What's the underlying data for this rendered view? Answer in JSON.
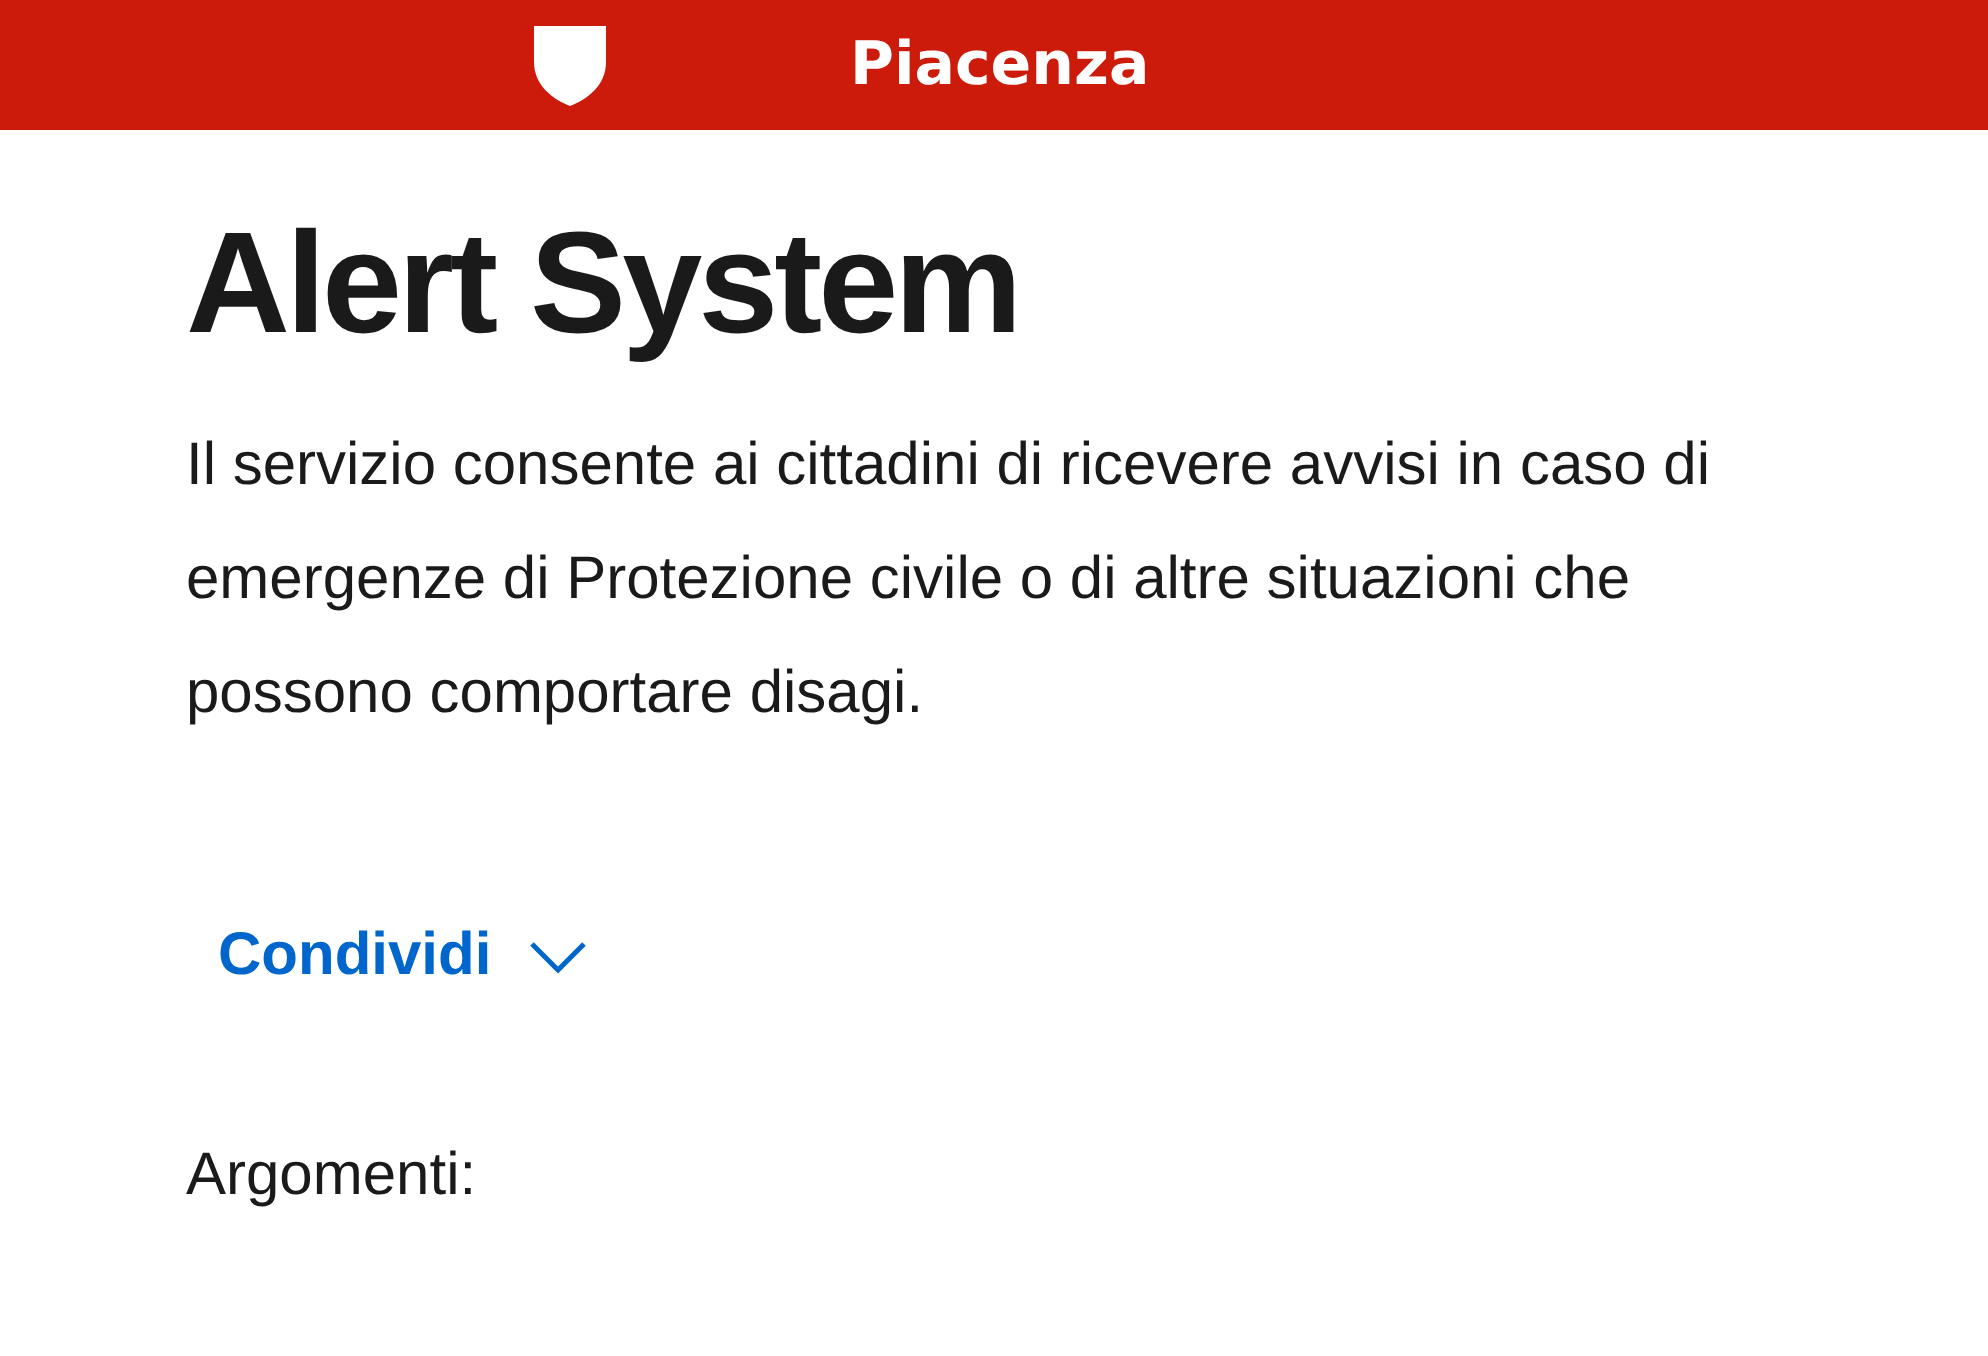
{
  "header": {
    "city": "Piacenza"
  },
  "title": "Alert System",
  "description": "Il servizio consente ai cittadini di ricevere avvisi in caso di emergenze di Protezione civile o di altre situazioni che possono comportare disagi.",
  "share": {
    "label": "Condividi",
    "expanded": false
  },
  "topics_label": "Argomenti:"
}
